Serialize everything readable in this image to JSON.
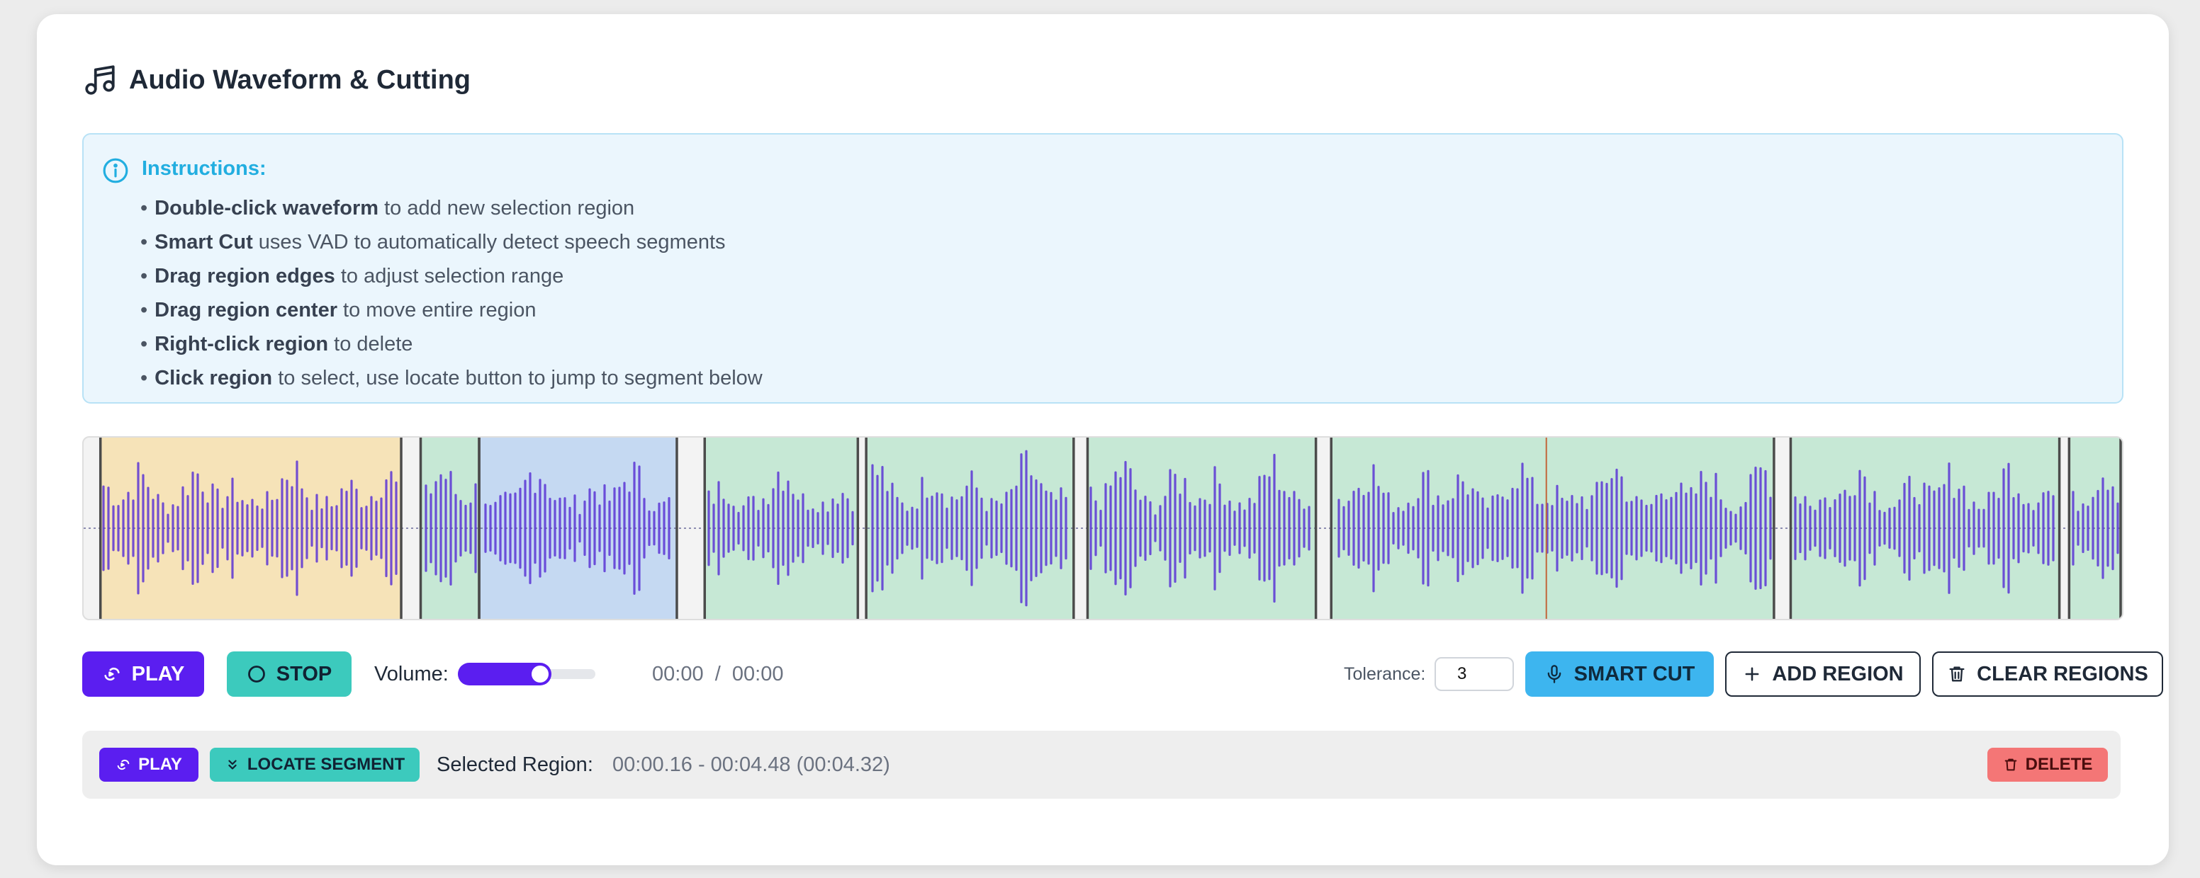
{
  "header": {
    "title": "Audio Waveform & Cutting",
    "icon": "music-note-icon"
  },
  "instructions": {
    "heading": "Instructions:",
    "items": [
      {
        "bold": "Double-click waveform",
        "text": " to add new selection region"
      },
      {
        "bold": "Smart Cut",
        "text": " uses VAD to automatically detect speech segments"
      },
      {
        "bold": "Drag region edges",
        "text": " to adjust selection range"
      },
      {
        "bold": "Drag region center",
        "text": " to move entire region"
      },
      {
        "bold": "Right-click region",
        "text": " to delete"
      },
      {
        "bold": "Click region",
        "text": " to select, use locate button to jump to segment below"
      }
    ]
  },
  "waveform": {
    "colors": {
      "wave": "#5b35d5",
      "region": "#c6e8d5",
      "selected": "#f6e3b8",
      "highlight": "#c5d9f2",
      "playhead": "#c2653a"
    },
    "regions": [
      {
        "start": 0.16,
        "end": 4.48,
        "state": "selected"
      },
      {
        "start": 4.76,
        "end": 5.6,
        "state": "normal"
      },
      {
        "start": 5.6,
        "end": 8.44,
        "state": "highlight"
      },
      {
        "start": 8.84,
        "end": 11.04,
        "state": "normal"
      },
      {
        "start": 11.16,
        "end": 14.14,
        "state": "normal"
      },
      {
        "start": 14.34,
        "end": 17.62,
        "state": "normal"
      },
      {
        "start": 17.84,
        "end": 24.2,
        "state": "normal"
      },
      {
        "start": 24.44,
        "end": 28.3,
        "state": "normal"
      },
      {
        "start": 28.44,
        "end": 29.2,
        "state": "normal"
      }
    ],
    "playhead_seconds": 20.93,
    "total_seconds": 29.2
  },
  "controls": {
    "play_label": "PLAY",
    "stop_label": "STOP",
    "volume_label": "Volume:",
    "volume_level": 0.6,
    "current_time": "00:00",
    "separator": "/",
    "total_time": "00:00",
    "tolerance_label": "Tolerance:",
    "tolerance_value": "3",
    "smart_cut_label": "SMART CUT",
    "add_region_label": "ADD REGION",
    "clear_regions_label": "CLEAR REGIONS"
  },
  "region_bar": {
    "play_label": "PLAY",
    "locate_label": "LOCATE SEGMENT",
    "selected_label": "Selected Region:",
    "selected_value": "00:00.16 - 00:04.48 (00:04.32)",
    "delete_label": "DELETE"
  }
}
